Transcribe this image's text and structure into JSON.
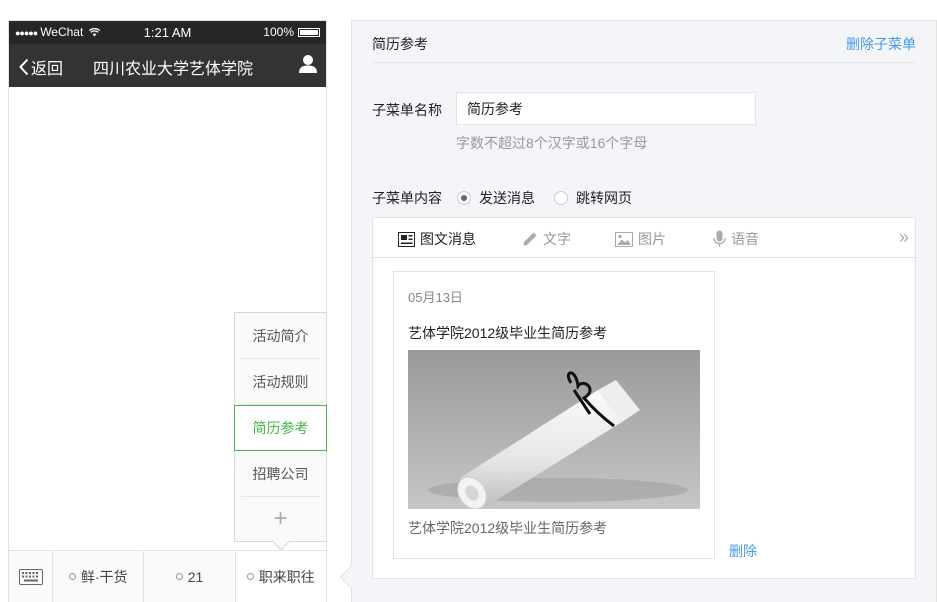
{
  "phone": {
    "status": {
      "dots": "●●●●●",
      "carrier": "WeChat",
      "time": "1:21 AM",
      "battery": "100%"
    },
    "nav": {
      "back": "返回",
      "title": "四川农业大学艺体学院"
    },
    "submenu": [
      {
        "label": "活动简介"
      },
      {
        "label": "活动规则"
      },
      {
        "label": "简历参考"
      },
      {
        "label": "招聘公司"
      }
    ],
    "submenu_add": "+",
    "menu_tabs": [
      {
        "label": "鲜·干货"
      },
      {
        "label": "21"
      },
      {
        "label": "职来职往"
      }
    ]
  },
  "editor": {
    "header_name": "简历参考",
    "delete_submenu": "删除子菜单",
    "name_label": "子菜单名称",
    "name_value": "简历参考",
    "name_hint": "字数不超过8个汉字或16个字母",
    "content_label": "子菜单内容",
    "radio_send": "发送消息",
    "radio_link": "跳转网页",
    "tabs": {
      "news": "图文消息",
      "text": "文字",
      "image": "图片",
      "voice": "语音",
      "more": "»"
    },
    "article": {
      "date": "05月13日",
      "title": "艺体学院2012级毕业生简历参考",
      "digest": "艺体学院2012级毕业生简历参考"
    },
    "article_delete": "删除"
  },
  "colors": {
    "accent_green": "#44b549",
    "link_blue": "#459ae9",
    "header_dark": "#333333"
  }
}
